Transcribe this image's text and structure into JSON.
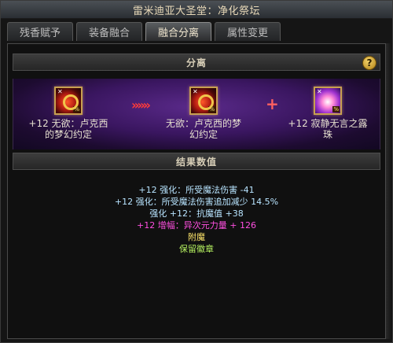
{
  "window": {
    "title": "雷米迪亚大圣堂：净化祭坛"
  },
  "tabs": [
    {
      "label": "残香赋予"
    },
    {
      "label": "装备融合"
    },
    {
      "label": "融合分离"
    },
    {
      "label": "属性变更"
    }
  ],
  "active_tab": "融合分离",
  "section_separate": {
    "title": "分离",
    "help_symbol": "?"
  },
  "separation": {
    "source": {
      "label_line1": "+12 无欲：卢克西",
      "label_line2": "的梦幻约定",
      "icon": "ring-icon"
    },
    "arrows": "»»»",
    "result_item": {
      "label_line1": "无欲：卢克西的梦",
      "label_line2": "幻约定",
      "icon": "ring-icon"
    },
    "plus": "+",
    "result_bead": {
      "label_line1": "+12 寂静无言之露",
      "label_line2": "珠",
      "icon": "bead-icon"
    }
  },
  "section_result": {
    "title": "结果数值"
  },
  "result_lines": [
    {
      "text": "+12 强化：所受魔法伤害 -41",
      "color": "#b8e4ff"
    },
    {
      "text": "+12 强化：所受魔法伤害追加减少 14.5%",
      "color": "#b8e4ff"
    },
    {
      "text": "强化 +12：抗魔值 +38",
      "color": "#b8e4ff"
    },
    {
      "text": "+12 增幅：异次元力量 + 126",
      "color": "#ff4fe1"
    },
    {
      "text": "附魔",
      "color": "#ffe66b"
    },
    {
      "text": "保留徽章",
      "color": "#b5f060"
    }
  ]
}
